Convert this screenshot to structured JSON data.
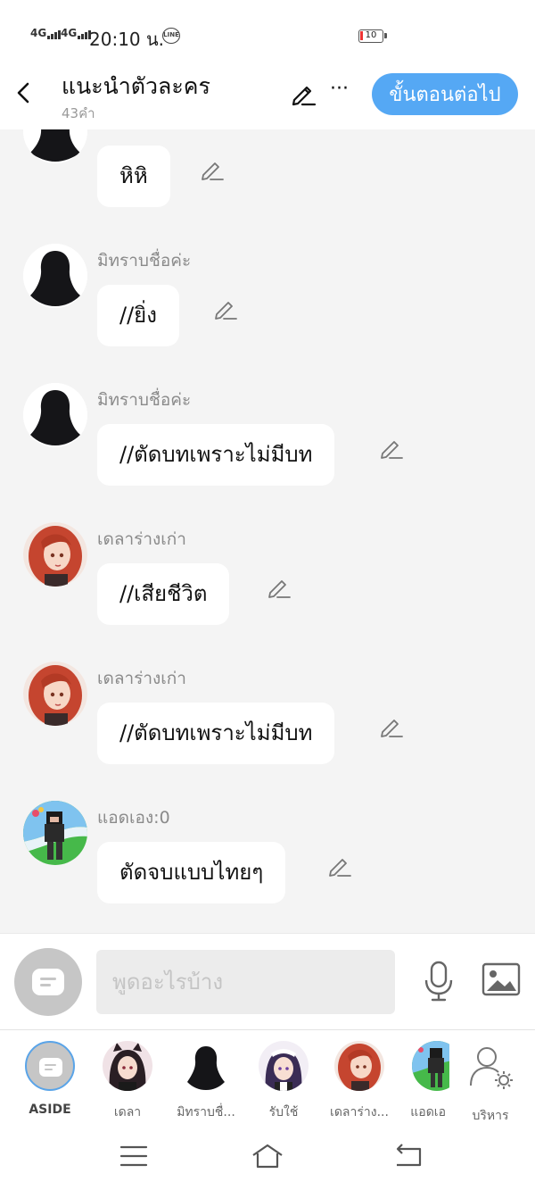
{
  "status_bar": {
    "signal_1": "4G",
    "signal_2": "4G",
    "time": "20:10 น.",
    "line_badge": "LINE",
    "battery": "10"
  },
  "header": {
    "title": "แนะนำตัวละคร",
    "subtitle": "43คำ",
    "next_button": "ขั้นตอนต่อไป",
    "more": "···"
  },
  "messages": [
    {
      "sender": "",
      "text": "หิหิ",
      "avatar": "silhouette"
    },
    {
      "sender": "มิทราบชื่อค่ะ",
      "text": "//ยิ่ง",
      "avatar": "silhouette"
    },
    {
      "sender": "มิทราบชื่อค่ะ",
      "text": "//ตัดบทเพราะไม่มีบท",
      "avatar": "silhouette"
    },
    {
      "sender": "เดลาร่างเก่า",
      "text": "//เสียชีวิต",
      "avatar": "red-hair-girl"
    },
    {
      "sender": "เดลาร่างเก่า",
      "text": "//ตัดบทเพราะไม่มีบท",
      "avatar": "red-hair-girl"
    },
    {
      "sender": "แอดเอง:0",
      "text": "ตัดจบแบบไทยๆ",
      "avatar": "game-character"
    }
  ],
  "input": {
    "placeholder": "พูดอะไรบ้าง"
  },
  "characters": [
    {
      "name": "ASIDE",
      "avatar": "aside"
    },
    {
      "name": "เดลา",
      "avatar": "dark-hair-cat-girl"
    },
    {
      "name": "มิทราบชื่...",
      "avatar": "silhouette"
    },
    {
      "name": "รับใช้",
      "avatar": "maid-girl"
    },
    {
      "name": "เดลาร่าง...",
      "avatar": "red-hair-girl"
    },
    {
      "name": "แอดเอ",
      "avatar": "game-character"
    },
    {
      "name": "บริหาร",
      "avatar": "manage-user-icon"
    }
  ],
  "colors": {
    "accent": "#55a8f4",
    "background": "#f4f4f4",
    "bubble": "#ffffff"
  }
}
